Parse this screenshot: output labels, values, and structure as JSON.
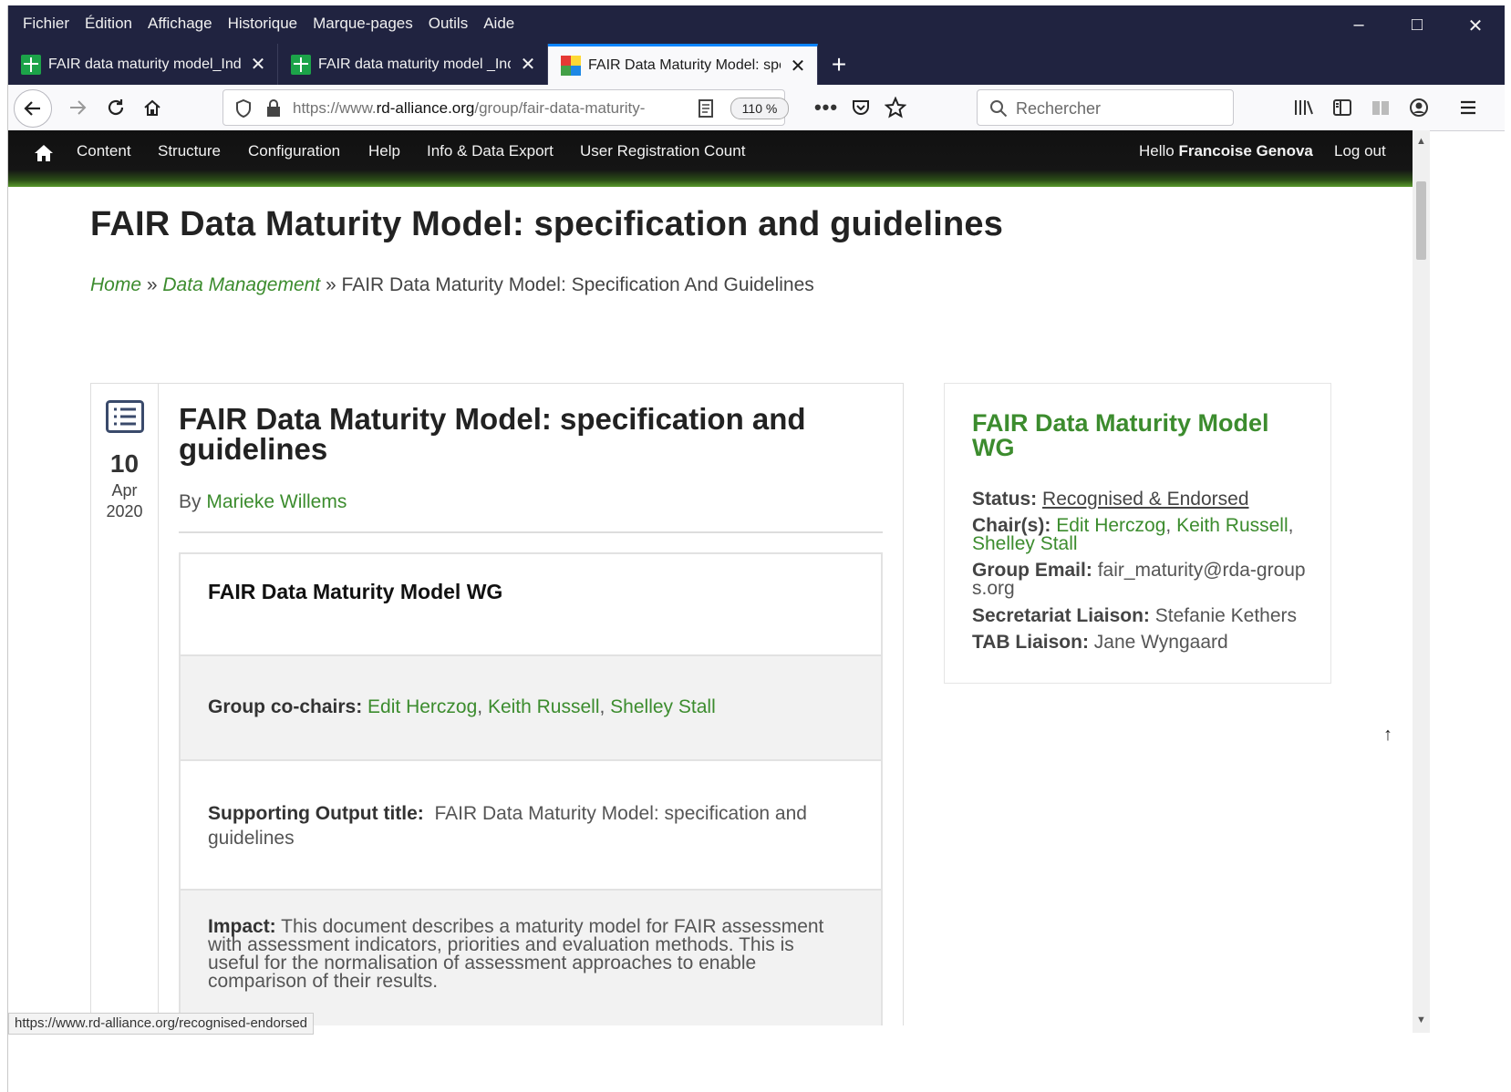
{
  "menubar": {
    "items": [
      "Fichier",
      "Édition",
      "Affichage",
      "Historique",
      "Marque-pages",
      "Outils",
      "Aide"
    ]
  },
  "window_controls": {
    "minimize": "–",
    "maximize": "□",
    "close": "✕"
  },
  "tabs": [
    {
      "label": "FAIR data maturity model_Indic",
      "icon": "spreadsheet-icon",
      "active": false
    },
    {
      "label": "FAIR data maturity model _Indi",
      "icon": "spreadsheet-icon",
      "active": false
    },
    {
      "label": "FAIR Data Maturity Model: spec",
      "icon": "rda-favicon",
      "active": true
    }
  ],
  "toolbar": {
    "url_prefix": "https://www.",
    "url_domain": "rd-alliance.org",
    "url_path": "/group/fair-data-maturity-",
    "zoom": "110 %",
    "search_placeholder": "Rechercher"
  },
  "admin_nav": {
    "items": [
      "Content",
      "Structure",
      "Configuration",
      "Help",
      "Info & Data Export",
      "User Registration Count"
    ],
    "hello_prefix": "Hello ",
    "user": "Francoise Genova",
    "logout": "Log out"
  },
  "page": {
    "title": "FAIR Data Maturity Model: specification and guidelines",
    "breadcrumb": {
      "home": "Home",
      "sep": " » ",
      "section": "Data Management",
      "current": "FAIR Data Maturity Model: Specification And Guidelines"
    }
  },
  "article": {
    "date": {
      "day": "10",
      "month": "Apr",
      "year": "2020"
    },
    "title": "FAIR Data Maturity Model: specification and guidelines",
    "by_label": "By ",
    "author": "Marieke Willems",
    "wg_heading": "FAIR Data Maturity Model WG",
    "cochairs_label": "Group co-chairs:",
    "cochairs": [
      "Edit Herczog",
      "Keith Russell",
      "Shelley Stall"
    ],
    "output_title_label": "Supporting Output title:",
    "output_title": "FAIR Data Maturity Model: specification and guidelines",
    "impact_label": "Impact:",
    "impact": "This document describes a maturity model for FAIR assessment with assessment indicators, priorities and evaluation methods. This is useful for the normalisation of assessment approaches to enable comparison of their results."
  },
  "sidebar": {
    "title": "FAIR Data Maturity Model WG",
    "status_label": "Status:",
    "status": "Recognised & Endorsed",
    "chairs_label": "Chair(s):",
    "chairs": [
      "Edit Herczog",
      "Keith Russell",
      "Shelley Stall"
    ],
    "email_label": "Group Email:",
    "email": "fair_maturity@rda-groups.org",
    "secretariat_label": "Secretariat Liaison:",
    "secretariat": "Stefanie Kethers",
    "tab_label": "TAB Liaison:",
    "tab": "Jane Wyngaard"
  },
  "status_url": "https://www.rd-alliance.org/recognised-endorsed",
  "colors": {
    "link_green": "#3c8c2e",
    "tab_accent": "#0a84ff",
    "titlebar": "#202340"
  }
}
